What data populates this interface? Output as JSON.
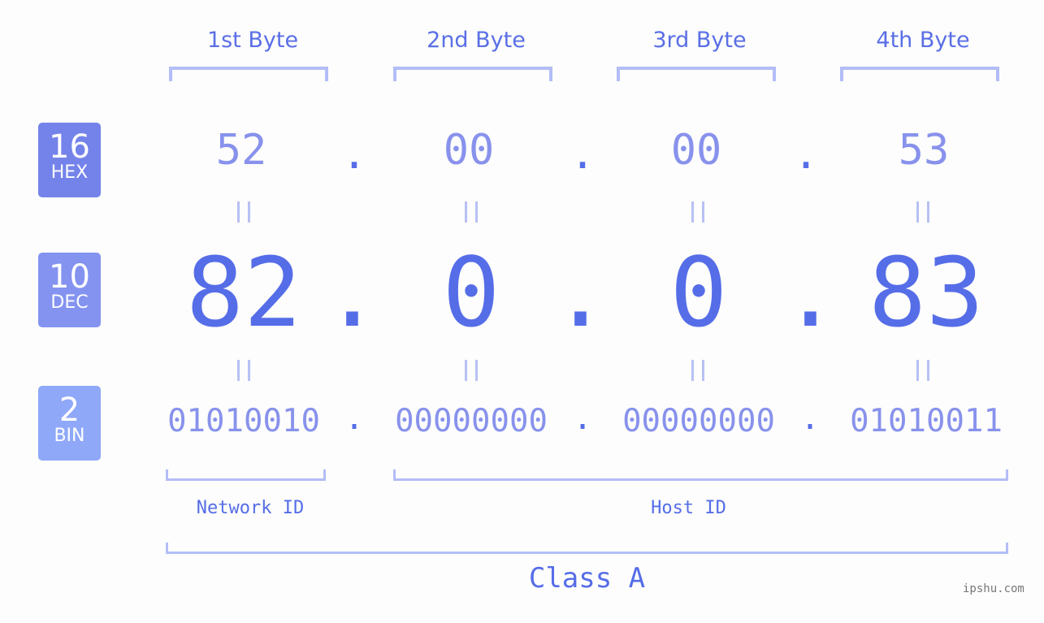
{
  "headers": [
    "1st Byte",
    "2nd Byte",
    "3rd Byte",
    "4th Byte"
  ],
  "badges": [
    {
      "num": "16",
      "label": "HEX",
      "color": "#7483ea"
    },
    {
      "num": "10",
      "label": "DEC",
      "color": "#8493f0"
    },
    {
      "num": "2",
      "label": "BIN",
      "color": "#8fa8f8"
    }
  ],
  "hex": [
    "52",
    "00",
    "00",
    "53"
  ],
  "dec": [
    "82",
    "0",
    "0",
    "83"
  ],
  "bin": [
    "01010010",
    "00000000",
    "00000000",
    "01010011"
  ],
  "separator": ".",
  "network_label": "Network ID",
  "host_label": "Host ID",
  "class_label": "Class A",
  "watermark": "ipshu.com"
}
